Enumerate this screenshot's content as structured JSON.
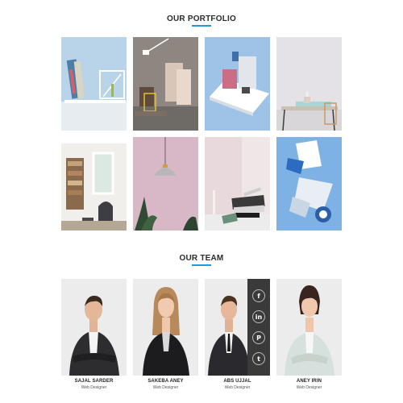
{
  "portfolio": {
    "title": "OUR PORTFOLIO",
    "accent": "#1f9bd6",
    "items": [
      {
        "icon": "shelf-books-image"
      },
      {
        "icon": "desk-lamp-image"
      },
      {
        "icon": "tray-objects-image"
      },
      {
        "icon": "table-vase-image"
      },
      {
        "icon": "living-room-image"
      },
      {
        "icon": "pendant-lamp-image"
      },
      {
        "icon": "books-candle-image"
      },
      {
        "icon": "folded-paper-image"
      }
    ]
  },
  "team": {
    "title": "OUR TEAM",
    "members": [
      {
        "name": "SAJAL SARDER",
        "role": "Web Designer"
      },
      {
        "name": "SAKEBA ANEY",
        "role": "Web Designer"
      },
      {
        "name": "ABS UJJAL",
        "role": "Web Designer"
      },
      {
        "name": "ANEY IRIN",
        "role": "Web Designer"
      }
    ],
    "social": [
      {
        "icon": "facebook-icon",
        "glyph": "f"
      },
      {
        "icon": "linkedin-icon",
        "glyph": "in"
      },
      {
        "icon": "pinterest-icon",
        "glyph": "P"
      },
      {
        "icon": "twitter-icon",
        "glyph": "t"
      }
    ]
  }
}
